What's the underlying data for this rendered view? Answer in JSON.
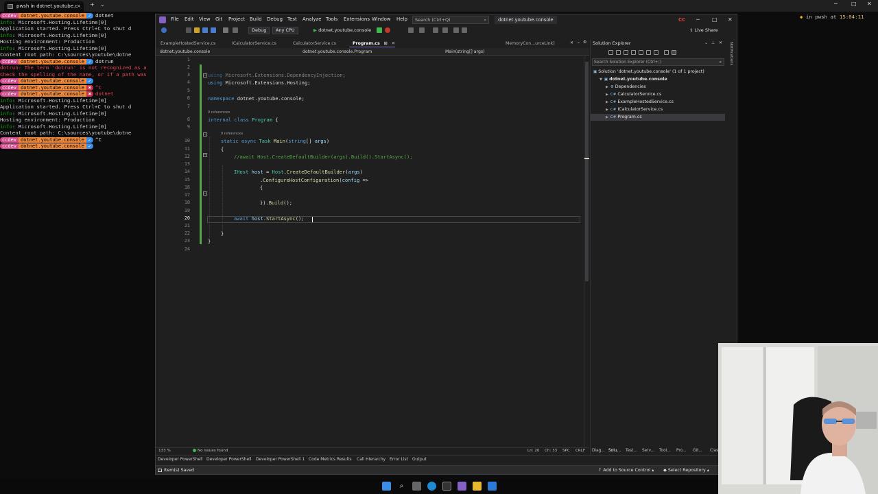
{
  "terminal": {
    "tab_title": "pwsh in dotnet.youtube.c",
    "right_status": {
      "shell": "in pwsh",
      "at": "at",
      "time": "15:04:11"
    },
    "lines": [
      {
        "kind": "prompt",
        "user": "ccdev",
        "dir": "dotnet.youtube.console",
        "status": "ok",
        "cmd": "dotnet"
      },
      {
        "kind": "text",
        "prefix": "info",
        "text": ": Microsoft.Hosting.Lifetime[0]"
      },
      {
        "kind": "text",
        "prefix": "",
        "text": "      Application started. Press Ctrl+C to shut d"
      },
      {
        "kind": "text",
        "prefix": "info",
        "text": ": Microsoft.Hosting.Lifetime[0]"
      },
      {
        "kind": "text",
        "prefix": "",
        "text": "      Hosting environment: Production"
      },
      {
        "kind": "text",
        "prefix": "info",
        "text": ": Microsoft.Hosting.Lifetime[0]"
      },
      {
        "kind": "text",
        "prefix": "",
        "text": "      Content root path: C:\\sources\\youtube\\dotne"
      },
      {
        "kind": "prompt",
        "user": "ccdev",
        "dir": "dotnet.youtube.console",
        "status": "ok",
        "cmd": "dotrun"
      },
      {
        "kind": "error",
        "text": "dotrun: The term 'dotrun' is not recognized as a"
      },
      {
        "kind": "error",
        "text": "Check the spelling of the name, or if a path was"
      },
      {
        "kind": "prompt",
        "user": "ccdev",
        "dir": "dotnet.youtube.console",
        "status": "ok",
        "cmd": ""
      },
      {
        "kind": "prompt",
        "user": "ccdev",
        "dir": "dotnet.youtube.console",
        "status": "x",
        "cmd": "^C"
      },
      {
        "kind": "prompt",
        "user": "ccdev",
        "dir": "dotnet.youtube.console",
        "status": "x",
        "cmd": "dotnet"
      },
      {
        "kind": "text",
        "prefix": "info",
        "text": ": Microsoft.Hosting.Lifetime[0]"
      },
      {
        "kind": "text",
        "prefix": "",
        "text": "      Application started. Press Ctrl+C to shut d"
      },
      {
        "kind": "text",
        "prefix": "info",
        "text": ": Microsoft.Hosting.Lifetime[0]"
      },
      {
        "kind": "text",
        "prefix": "",
        "text": "      Hosting environment: Production"
      },
      {
        "kind": "text",
        "prefix": "info",
        "text": ": Microsoft.Hosting.Lifetime[0]"
      },
      {
        "kind": "text",
        "prefix": "",
        "text": "      Content root path: C:\\sources\\youtube\\dotne"
      },
      {
        "kind": "prompt",
        "user": "ccdev",
        "dir": "dotnet.youtube.console",
        "status": "ok",
        "cmd": "^C"
      },
      {
        "kind": "prompt",
        "user": "ccdev",
        "dir": "dotnet.youtube.console",
        "status": "ok",
        "cmd": ""
      }
    ]
  },
  "vs": {
    "menu": [
      "File",
      "Edit",
      "View",
      "Git",
      "Project",
      "Build",
      "Debug",
      "Test",
      "Analyze",
      "Tools",
      "Extensions",
      "Window",
      "Help"
    ],
    "search_placeholder": "Search (Ctrl+Q)",
    "solution_title": "dotnet.youtube.console",
    "cc_badge": "CC",
    "toolbar": {
      "config": "Debug",
      "platform": "Any CPU",
      "run_target": "dotnet.youtube.console",
      "live_share": "Live Share"
    },
    "doc_tabs": [
      {
        "label": "ExampleHostedService.cs",
        "active": false
      },
      {
        "label": "ICalculatorService.cs",
        "active": false
      },
      {
        "label": "CalculatorService.cs",
        "active": false
      },
      {
        "label": "Program.cs",
        "active": true
      },
      {
        "label": "MemoryCon...urceLink]",
        "active": false
      }
    ],
    "nav": {
      "project": "dotnet.youtube.console",
      "type": "dotnet.youtube.console.Program",
      "member": "Main(string[] args)"
    },
    "code_lines": [
      "1",
      "2",
      "3",
      "4",
      "5",
      "6",
      "7",
      "8",
      "9",
      "10",
      "11",
      "12",
      "13",
      "14",
      "15",
      "16",
      "17",
      "18",
      "19",
      "20",
      "21",
      "22",
      "23",
      "24"
    ],
    "refs_label": "0 references",
    "editor_status": {
      "zoom": "133 %",
      "issues": "No issues found",
      "ln": "Ln: 20",
      "ch": "Ch: 33",
      "spc": "SPC",
      "crlf": "CRLF"
    },
    "tool_tabs": [
      "Developer PowerShell",
      "Developer PowerShell",
      "Developer PowerShell 1",
      "Code Metrics Results",
      "Call Hierarchy",
      "Error List",
      "Output"
    ],
    "status": {
      "message": "Item(s) Saved",
      "source_control": "Add to Source Control",
      "repo": "Select Repository"
    },
    "solution_explorer": {
      "title": "Solution Explorer",
      "search_placeholder": "Search Solution Explorer (Ctrl+;)",
      "items": [
        {
          "label": "Solution 'dotnet.youtube.console' (1 of 1 project)",
          "level": 0
        },
        {
          "label": "dotnet.youtube.console",
          "level": 1
        },
        {
          "label": "Dependencies",
          "level": 2
        },
        {
          "label": "CalculatorService.cs",
          "level": 2
        },
        {
          "label": "ExampleHostedService.cs",
          "level": 2
        },
        {
          "label": "ICalculatorService.cs",
          "level": 2
        },
        {
          "label": "Program.cs",
          "level": 2
        }
      ],
      "bottom_tabs": [
        "Diag...",
        "Solu...",
        "Test...",
        "Serv...",
        "Tool...",
        "Pro...",
        "Git...",
        "Class"
      ]
    },
    "notifications": "Notifications"
  },
  "colors": {
    "vs_accent": "#8661c5",
    "keyword": "#569cd6",
    "type": "#4ec9b0",
    "method": "#dcdcaa",
    "comment": "#57a64a",
    "prompt_user": "#d24a8c",
    "prompt_dir": "#f08a3a",
    "prompt_ok": "#3a8ee6"
  }
}
